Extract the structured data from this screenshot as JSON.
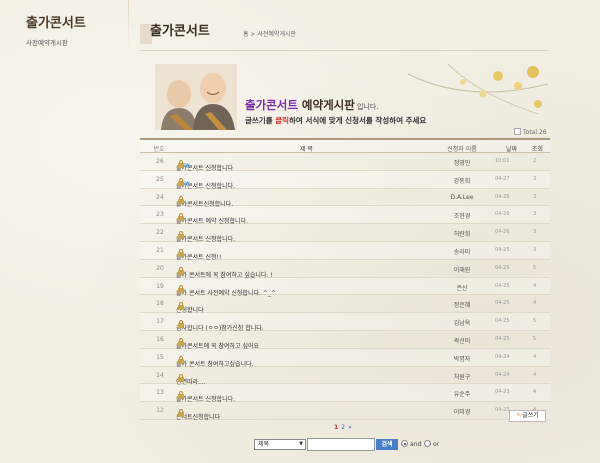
{
  "sidebar": {
    "title": "출가콘서트",
    "subtitle": "사전예약게시판"
  },
  "header": {
    "title": "출가콘서트",
    "breadcrumb": "홈 > 사전예약게시판"
  },
  "banner": {
    "title_highlight": "출가콘서트",
    "title_main": " 예약게시판",
    "title_suffix": " 입니다.",
    "desc_prefix": "글쓰기를 ",
    "desc_red": "클릭",
    "desc_suffix": "하여 서식에 맞게 신청서를 작성하여 주세요"
  },
  "total_label": "Total 26",
  "table": {
    "headers": {
      "no": "번호",
      "title": "제 목",
      "name": "신청자 이름",
      "date": "날짜",
      "hits": "조회"
    },
    "rows": [
      {
        "no": "26",
        "title": "출가콘서트 신청합니다",
        "new": true,
        "name": "정영민",
        "date": "10:01",
        "hits": "2"
      },
      {
        "no": "25",
        "title": "출가콘서트 신청합니다.",
        "new": true,
        "name": "강동희",
        "date": "04-27",
        "hits": "3"
      },
      {
        "no": "24",
        "title": "출가콘서트신청합니다.",
        "new": false,
        "name": "D.A.Lee",
        "date": "04-26",
        "hits": "3"
      },
      {
        "no": "23",
        "title": "출가콘서트 예약 신청합니다.",
        "new": false,
        "name": "조현경",
        "date": "04-26",
        "hits": "3"
      },
      {
        "no": "22",
        "title": "출가콘서트 신청합니다.",
        "new": false,
        "name": "허란희",
        "date": "04-26",
        "hits": "3"
      },
      {
        "no": "21",
        "title": "출가콘서트 신청!!",
        "new": false,
        "name": "송라미",
        "date": "04-25",
        "hits": "3"
      },
      {
        "no": "20",
        "title": "출가 콘서트에 꼭 참여하고 싶습니다. !",
        "new": false,
        "name": "이재원",
        "date": "04-25",
        "hits": "5"
      },
      {
        "no": "19",
        "title": "출가 콘서트 사전예약 신청합니다. ^_^",
        "new": false,
        "name": "은산",
        "date": "04-25",
        "hits": "4"
      },
      {
        "no": "18",
        "title": "신청합니다",
        "new": false,
        "name": "정은혜",
        "date": "04-25",
        "hits": "4"
      },
      {
        "no": "17",
        "title": "감사합니다 (ㅇㅇ)참가신청 합니다.",
        "new": false,
        "name": "김남욱",
        "date": "04-25",
        "hits": "5"
      },
      {
        "no": "16",
        "title": "출가콘서트에 꼭 참여하고 싶어요",
        "new": false,
        "name": "곽선미",
        "date": "04-25",
        "hits": "5"
      },
      {
        "no": "15",
        "title": "출가 콘서트 참여하고싶습니다.",
        "new": false,
        "name": "박명자",
        "date": "04-24",
        "hits": "4"
      },
      {
        "no": "14",
        "title": "인연따라....",
        "new": false,
        "name": "처원구",
        "date": "04-24",
        "hits": "4"
      },
      {
        "no": "13",
        "title": "출가콘서트 신청합니다.",
        "new": false,
        "name": "유순주",
        "date": "04-23",
        "hits": "4"
      },
      {
        "no": "12",
        "title": "콘서트신청합니다",
        "new": false,
        "name": "이미경",
        "date": "04-23",
        "hits": "4"
      }
    ]
  },
  "write_button": "글쓰기",
  "pagination": {
    "current": "1",
    "pages": [
      "2"
    ],
    "next": "»"
  },
  "search": {
    "select_value": "제목",
    "button": "검색",
    "radio_and": "and",
    "radio_or": "or"
  },
  "colors": {
    "accent_red": "#e0312b",
    "accent_purple": "#7a2ea8",
    "button_blue": "#4a7fc8"
  }
}
